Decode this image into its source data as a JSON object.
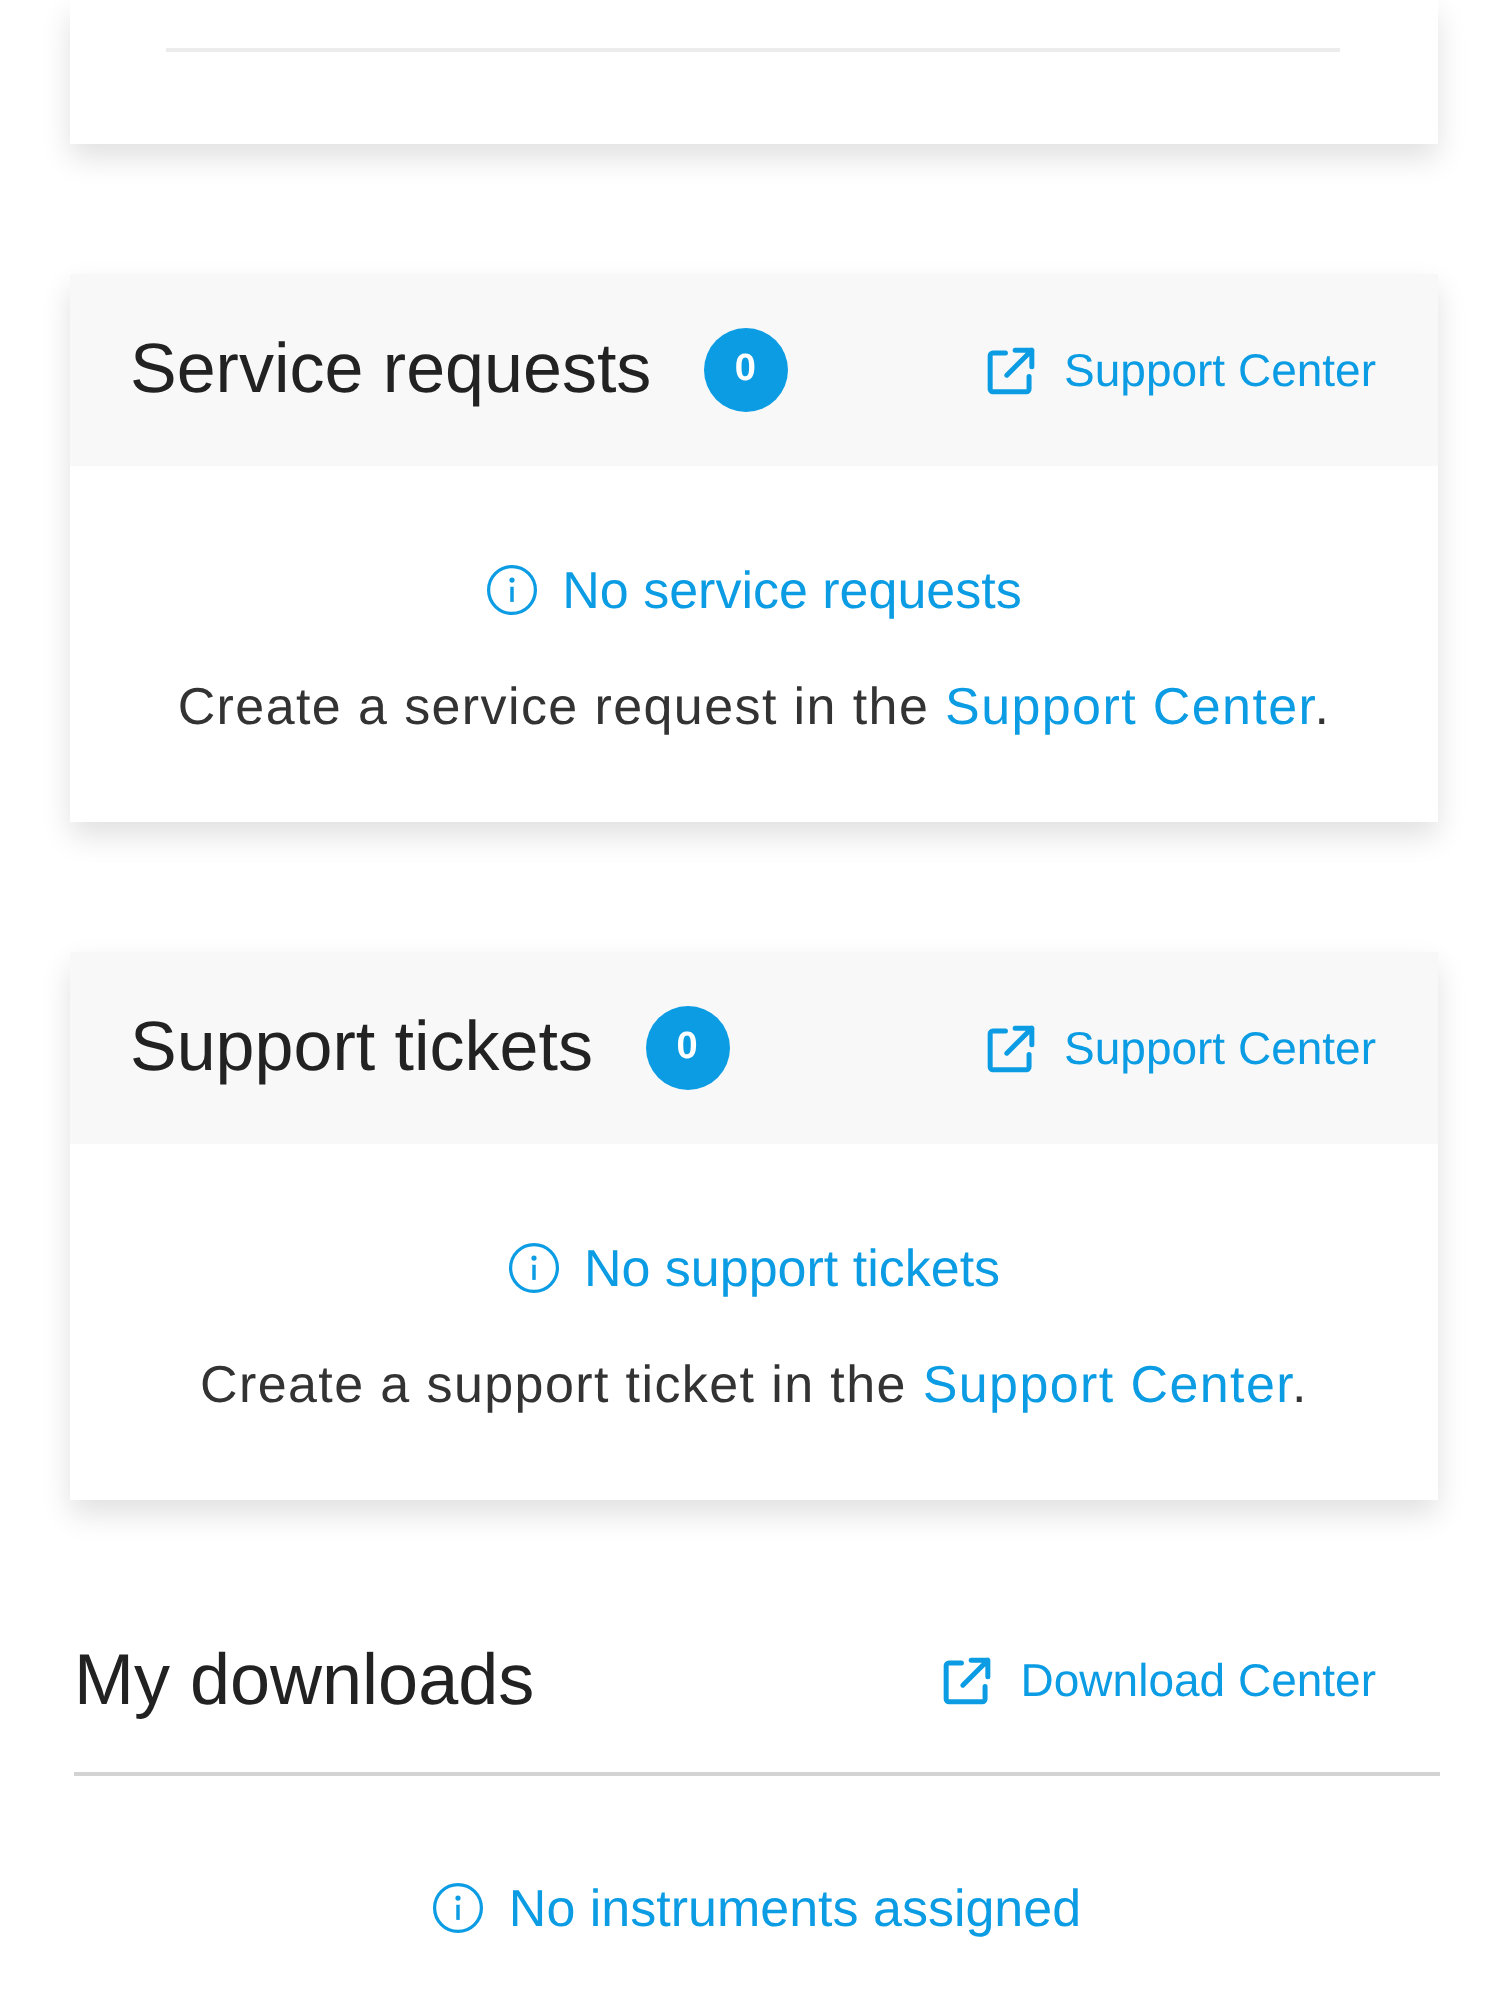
{
  "sections": [
    {
      "kind": "card",
      "title": "Service requests",
      "count": "0",
      "link": "Support Center",
      "empty_title": "No service requests",
      "empty_text": {
        "before": "Create a service request in the ",
        "link": "Support Center",
        "after": "."
      }
    },
    {
      "kind": "card",
      "title": "Support tickets",
      "count": "0",
      "link": "Support Center",
      "empty_title": "No support tickets",
      "empty_text": {
        "before": "Create a support ticket in the ",
        "link": "Support Center",
        "after": "."
      }
    },
    {
      "kind": "plain",
      "title": "My downloads",
      "link": "Download Center",
      "empty_title": "No instruments assigned"
    }
  ]
}
